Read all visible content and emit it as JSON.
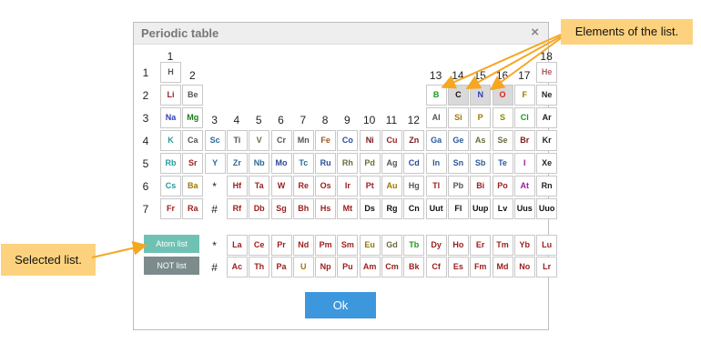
{
  "dialog": {
    "title": "Periodic table",
    "close_symbol": "×",
    "ok_label": "Ok"
  },
  "buttons": {
    "atom_list": "Atom list",
    "not_list": "NOT list"
  },
  "callouts": {
    "elements": "Elements of the list.",
    "selected": "Selected list."
  },
  "colors": {
    "callout_bg": "#fdd27e",
    "arrow": "#f5a623",
    "ok_button": "#3d97dd",
    "atom_list_button": "#6fc2b3",
    "not_list_button": "#7c8b8c"
  },
  "group_labels": [
    "1",
    "2",
    "3",
    "4",
    "5",
    "6",
    "7",
    "8",
    "9",
    "10",
    "11",
    "12",
    "13",
    "14",
    "15",
    "16",
    "17",
    "18"
  ],
  "period_labels": [
    "1",
    "2",
    "3",
    "4",
    "5",
    "6",
    "7"
  ],
  "markers": {
    "lanthanide_star": "*",
    "actinide_hash": "#"
  },
  "main_table": [
    [
      {
        "s": "H",
        "c": "#555555",
        "g": 1
      },
      {
        "s": "He",
        "c": "#b05a5a",
        "g": 18
      }
    ],
    [
      {
        "s": "Li",
        "c": "#9b1c1c",
        "g": 1
      },
      {
        "s": "Be",
        "c": "#555555",
        "g": 2
      },
      {
        "s": "B",
        "c": "#1a9a1a",
        "g": 13
      },
      {
        "s": "C",
        "c": "#111111",
        "g": 14,
        "sel": true
      },
      {
        "s": "N",
        "c": "#2a3fb5",
        "g": 15,
        "sel": true
      },
      {
        "s": "O",
        "c": "#e01b1b",
        "g": 16,
        "sel": true
      },
      {
        "s": "F",
        "c": "#9a7a00",
        "g": 17
      },
      {
        "s": "Ne",
        "c": "#222222",
        "g": 18
      }
    ],
    [
      {
        "s": "Na",
        "c": "#2a3fb5",
        "g": 1
      },
      {
        "s": "Mg",
        "c": "#1a7a1a",
        "g": 2
      },
      {
        "s": "Al",
        "c": "#555555",
        "g": 13
      },
      {
        "s": "Si",
        "c": "#a07800",
        "g": 14
      },
      {
        "s": "P",
        "c": "#a07800",
        "g": 15
      },
      {
        "s": "S",
        "c": "#8a8a00",
        "g": 16
      },
      {
        "s": "Cl",
        "c": "#1a9a1a",
        "g": 17
      },
      {
        "s": "Ar",
        "c": "#222222",
        "g": 18
      }
    ],
    [
      {
        "s": "K",
        "c": "#2a9a9a",
        "g": 1
      },
      {
        "s": "Ca",
        "c": "#555555",
        "g": 2
      },
      {
        "s": "Sc",
        "c": "#2a6a9a",
        "g": 3
      },
      {
        "s": "Ti",
        "c": "#555555",
        "g": 4
      },
      {
        "s": "V",
        "c": "#6b6b3a",
        "g": 5
      },
      {
        "s": "Cr",
        "c": "#555555",
        "g": 6
      },
      {
        "s": "Mn",
        "c": "#555555",
        "g": 7
      },
      {
        "s": "Fe",
        "c": "#9a5a1a",
        "g": 8
      },
      {
        "s": "Co",
        "c": "#2a4a9a",
        "g": 9
      },
      {
        "s": "Ni",
        "c": "#7a1a1a",
        "g": 10
      },
      {
        "s": "Cu",
        "c": "#9b1c1c",
        "g": 11
      },
      {
        "s": "Zn",
        "c": "#7a1a1a",
        "g": 12
      },
      {
        "s": "Ga",
        "c": "#2a5a9a",
        "g": 13
      },
      {
        "s": "Ge",
        "c": "#2a5a9a",
        "g": 14
      },
      {
        "s": "As",
        "c": "#6b6b3a",
        "g": 15
      },
      {
        "s": "Se",
        "c": "#6b6b3a",
        "g": 16
      },
      {
        "s": "Br",
        "c": "#7a1a1a",
        "g": 17
      },
      {
        "s": "Kr",
        "c": "#222222",
        "g": 18
      }
    ],
    [
      {
        "s": "Rb",
        "c": "#2a9a9a",
        "g": 1
      },
      {
        "s": "Sr",
        "c": "#9b1c1c",
        "g": 2
      },
      {
        "s": "Y",
        "c": "#2a6a9a",
        "g": 3
      },
      {
        "s": "Zr",
        "c": "#2a6a9a",
        "g": 4
      },
      {
        "s": "Nb",
        "c": "#2a6a9a",
        "g": 5
      },
      {
        "s": "Mo",
        "c": "#2a4a9a",
        "g": 6
      },
      {
        "s": "Tc",
        "c": "#2a6a9a",
        "g": 7
      },
      {
        "s": "Ru",
        "c": "#2a4a9a",
        "g": 8
      },
      {
        "s": "Rh",
        "c": "#6b6b3a",
        "g": 9
      },
      {
        "s": "Pd",
        "c": "#6b6b3a",
        "g": 10
      },
      {
        "s": "Ag",
        "c": "#555555",
        "g": 11
      },
      {
        "s": "Cd",
        "c": "#2a4a9a",
        "g": 12
      },
      {
        "s": "In",
        "c": "#2a5a9a",
        "g": 13
      },
      {
        "s": "Sn",
        "c": "#2a5a9a",
        "g": 14
      },
      {
        "s": "Sb",
        "c": "#2a5a9a",
        "g": 15
      },
      {
        "s": "Te",
        "c": "#2a5a9a",
        "g": 16
      },
      {
        "s": "I",
        "c": "#9b1c9b",
        "g": 17
      },
      {
        "s": "Xe",
        "c": "#222222",
        "g": 18
      }
    ],
    [
      {
        "s": "Cs",
        "c": "#2a9a9a",
        "g": 1
      },
      {
        "s": "Ba",
        "c": "#9a7a00",
        "g": 2
      },
      {
        "s": "*",
        "c": "#222222",
        "g": 3,
        "marker": true
      },
      {
        "s": "Hf",
        "c": "#9b1c1c",
        "g": 4
      },
      {
        "s": "Ta",
        "c": "#9b1c1c",
        "g": 5
      },
      {
        "s": "W",
        "c": "#9b1c1c",
        "g": 6
      },
      {
        "s": "Re",
        "c": "#9b1c1c",
        "g": 7
      },
      {
        "s": "Os",
        "c": "#9b1c1c",
        "g": 8
      },
      {
        "s": "Ir",
        "c": "#9b1c1c",
        "g": 9
      },
      {
        "s": "Pt",
        "c": "#9b1c1c",
        "g": 10
      },
      {
        "s": "Au",
        "c": "#a07800",
        "g": 11
      },
      {
        "s": "Hg",
        "c": "#555555",
        "g": 12
      },
      {
        "s": "Tl",
        "c": "#9b1c1c",
        "g": 13
      },
      {
        "s": "Pb",
        "c": "#555555",
        "g": 14
      },
      {
        "s": "Bi",
        "c": "#9b1c1c",
        "g": 15
      },
      {
        "s": "Po",
        "c": "#9b1c1c",
        "g": 16
      },
      {
        "s": "At",
        "c": "#9b1c9b",
        "g": 17
      },
      {
        "s": "Rn",
        "c": "#222222",
        "g": 18
      }
    ],
    [
      {
        "s": "Fr",
        "c": "#9b1c1c",
        "g": 1
      },
      {
        "s": "Ra",
        "c": "#9b1c1c",
        "g": 2
      },
      {
        "s": "#",
        "c": "#222222",
        "g": 3,
        "marker": true
      },
      {
        "s": "Rf",
        "c": "#9b1c1c",
        "g": 4
      },
      {
        "s": "Db",
        "c": "#9b1c1c",
        "g": 5
      },
      {
        "s": "Sg",
        "c": "#9b1c1c",
        "g": 6
      },
      {
        "s": "Bh",
        "c": "#9b1c1c",
        "g": 7
      },
      {
        "s": "Hs",
        "c": "#9b1c1c",
        "g": 8
      },
      {
        "s": "Mt",
        "c": "#9b1c1c",
        "g": 9
      },
      {
        "s": "Ds",
        "c": "#111111",
        "g": 10
      },
      {
        "s": "Rg",
        "c": "#111111",
        "g": 11
      },
      {
        "s": "Cn",
        "c": "#111111",
        "g": 12
      },
      {
        "s": "Uut",
        "c": "#111111",
        "g": 13
      },
      {
        "s": "Fl",
        "c": "#111111",
        "g": 14
      },
      {
        "s": "Uup",
        "c": "#111111",
        "g": 15
      },
      {
        "s": "Lv",
        "c": "#111111",
        "g": 16
      },
      {
        "s": "Uus",
        "c": "#111111",
        "g": 17
      },
      {
        "s": "Uuo",
        "c": "#111111",
        "g": 18
      }
    ]
  ],
  "lanthanides": [
    {
      "s": "La",
      "c": "#9b1c1c"
    },
    {
      "s": "Ce",
      "c": "#9b1c1c"
    },
    {
      "s": "Pr",
      "c": "#9b1c1c"
    },
    {
      "s": "Nd",
      "c": "#9b1c1c"
    },
    {
      "s": "Pm",
      "c": "#9b1c1c"
    },
    {
      "s": "Sm",
      "c": "#9b1c1c"
    },
    {
      "s": "Eu",
      "c": "#8a7a00"
    },
    {
      "s": "Gd",
      "c": "#6b6b3a"
    },
    {
      "s": "Tb",
      "c": "#1a9a1a"
    },
    {
      "s": "Dy",
      "c": "#9b1c1c"
    },
    {
      "s": "Ho",
      "c": "#9b1c1c"
    },
    {
      "s": "Er",
      "c": "#9b1c1c"
    },
    {
      "s": "Tm",
      "c": "#9b1c1c"
    },
    {
      "s": "Yb",
      "c": "#9b1c1c"
    },
    {
      "s": "Lu",
      "c": "#9b1c1c"
    }
  ],
  "actinides": [
    {
      "s": "Ac",
      "c": "#9b1c1c"
    },
    {
      "s": "Th",
      "c": "#9b1c1c"
    },
    {
      "s": "Pa",
      "c": "#9b1c1c"
    },
    {
      "s": "U",
      "c": "#a07800"
    },
    {
      "s": "Np",
      "c": "#9b1c1c"
    },
    {
      "s": "Pu",
      "c": "#9b1c1c"
    },
    {
      "s": "Am",
      "c": "#9b1c1c"
    },
    {
      "s": "Cm",
      "c": "#9b1c1c"
    },
    {
      "s": "Bk",
      "c": "#9b1c1c"
    },
    {
      "s": "Cf",
      "c": "#9b1c1c"
    },
    {
      "s": "Es",
      "c": "#9b1c1c"
    },
    {
      "s": "Fm",
      "c": "#9b1c1c"
    },
    {
      "s": "Md",
      "c": "#9b1c1c"
    },
    {
      "s": "No",
      "c": "#9b1c1c"
    },
    {
      "s": "Lr",
      "c": "#9b1c1c"
    }
  ]
}
